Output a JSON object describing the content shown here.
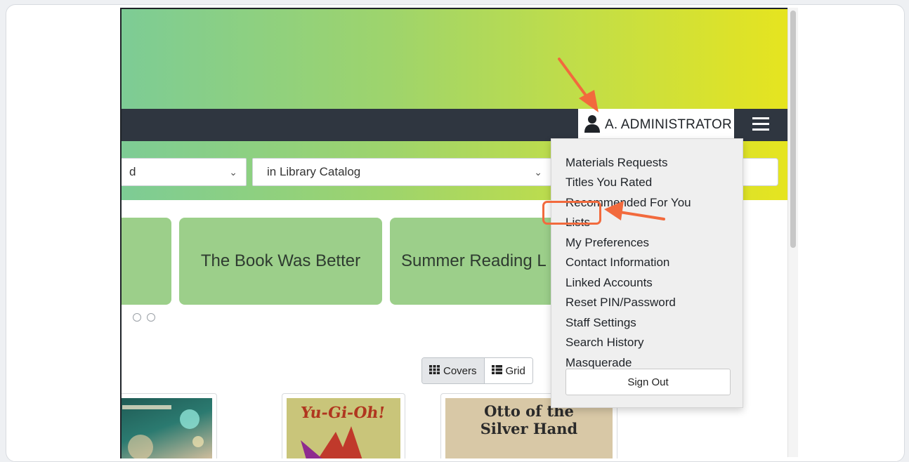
{
  "navbar": {
    "user_label": "A. ADMINISTRATOR",
    "user_icon": "user-icon",
    "menu_icon": "hamburger-menu-icon"
  },
  "search": {
    "type_select_value": "d",
    "scope_select_value": "in Library Catalog"
  },
  "browse": {
    "tiles": [
      "",
      "The Book Was Better",
      "Summer Reading L"
    ]
  },
  "view": {
    "covers_label": "Covers",
    "grid_label": "Grid"
  },
  "account_menu": {
    "items": [
      "Materials Requests",
      "Titles You Rated",
      "Recommended For You",
      "Lists",
      "My Preferences",
      "Contact Information",
      "Linked Accounts",
      "Reset PIN/Password",
      "Staff Settings",
      "Search History",
      "Masquerade"
    ],
    "sign_out": "Sign Out"
  },
  "covers": [
    {
      "title_line1": "",
      "title_line2": ""
    },
    {
      "title_line1": "Yu-Gi-Oh!",
      "title_line2": ""
    },
    {
      "title_line1": "Otto of the",
      "title_line2": "Silver Hand"
    }
  ],
  "colors": {
    "accent": "#f26a3d",
    "navbar": "#2f3640",
    "tile": "#9ccf8a",
    "banner_start": "#7dcc95",
    "banner_end": "#e6e41f"
  }
}
